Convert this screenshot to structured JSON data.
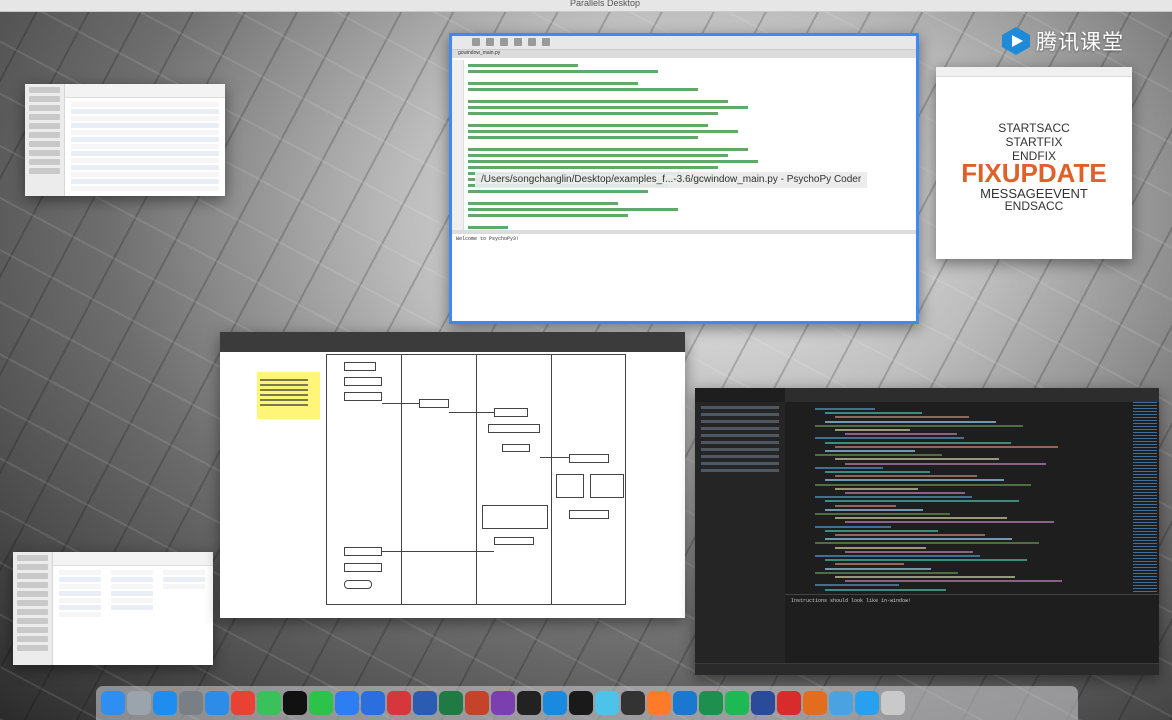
{
  "topbar": {
    "app_name": "Parallels Desktop"
  },
  "coder_window": {
    "tab_label": "gcwindow_main.py",
    "tooltip": "/Users/songchanglin/Desktop/examples_f...-3.6/gcwindow_main.py - PsychoPy Coder",
    "shell_text": "Welcome to PsychoPy3!"
  },
  "wordcloud": {
    "words": [
      "STARTSACC",
      "STARTFIX",
      "ENDFIX",
      "FIXUPDATE",
      "MESSAGEEVENT",
      "ENDSACC"
    ],
    "colors": {
      "main": "#e0602a",
      "others": "#333333"
    }
  },
  "vscode": {
    "terminal_text": "Instructions should look like in-window!"
  },
  "logo": {
    "text": "腾讯课堂",
    "accent": "#1e8ad8"
  },
  "dock": {
    "icons": [
      "finder-icon",
      "launchpad-icon",
      "appstore-icon",
      "system-prefs-icon",
      "safari-icon",
      "chrome-icon",
      "messages-icon",
      "qq-icon",
      "wechat-icon",
      "wecom-icon",
      "dingtalk-icon",
      "tencent-icon",
      "word-icon",
      "excel-icon",
      "powerpoint-icon",
      "onenote-icon",
      "terminal-icon",
      "xcode-icon",
      "typora-icon",
      "mindnode-icon",
      "activity-icon",
      "sublime-icon",
      "vscode-icon",
      "pycharm-icon",
      "spotify-icon",
      "webex-icon",
      "pdf-icon",
      "matlab-icon",
      "folder-icon",
      "classroom-icon",
      "trash-icon"
    ],
    "colors": [
      "#2f8ef2",
      "#9ba3ad",
      "#1f8df0",
      "#7a7f86",
      "#2d8ce8",
      "#e94235",
      "#39c15c",
      "#111111",
      "#2cc34b",
      "#2d7df3",
      "#2a6ee0",
      "#d7363c",
      "#2b5cb4",
      "#1f7a43",
      "#c5432a",
      "#7b3fb0",
      "#222222",
      "#1a8ae0",
      "#1a1a1a",
      "#4cc3e8",
      "#333333",
      "#ff7a29",
      "#1b78d0",
      "#1d8f4f",
      "#1db954",
      "#2c4a9a",
      "#d82b2b",
      "#e36c1d",
      "#4aa3e0",
      "#28a0f0",
      "#c9c9c9"
    ]
  }
}
